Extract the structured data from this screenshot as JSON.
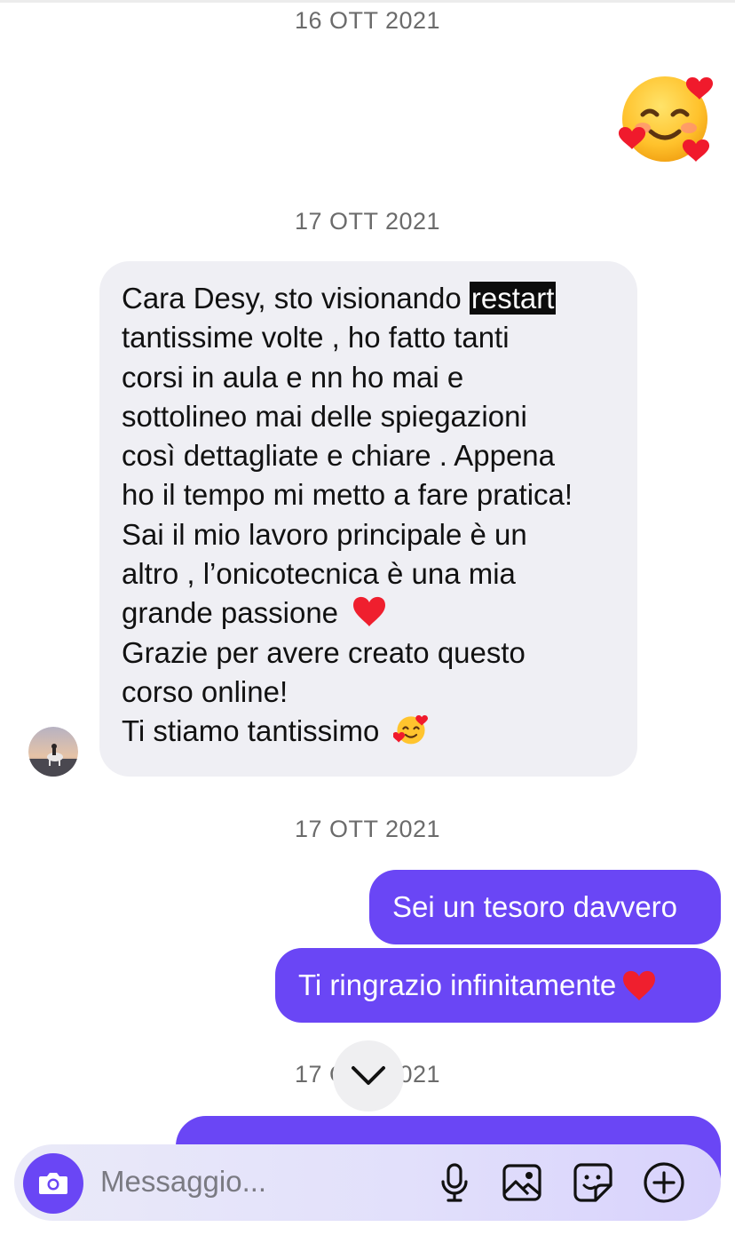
{
  "dates": [
    "16 OTT 2021",
    "17 OTT 2021",
    "17 OTT 2021",
    "17 OTT 2021"
  ],
  "sent_emoji": "smiling-face-with-hearts",
  "incoming": {
    "lines": [
      "Cara Desy, sto visionando ",
      "restart",
      "tantissime volte , ho fatto tanti",
      "corsi in aula e nn ho mai e",
      "sottolineo mai delle spiegazioni",
      "così dettagliate e chiare . Appena",
      "ho il tempo mi metto a fare pratica!",
      "Sai il mio lavoro principale è un",
      "altro , l’onicotecnica è una mia",
      "grande passione ",
      "Grazie per avere creato questo",
      "corso online!",
      "Ti stiamo tantissimo "
    ]
  },
  "outgoing": [
    {
      "text": "Sei un tesoro davvero"
    },
    {
      "text": "Ti ringrazio infinitamente "
    }
  ],
  "composer": {
    "placeholder": "Messaggio...",
    "icons": [
      "camera-icon",
      "microphone-icon",
      "gallery-icon",
      "sticker-icon",
      "plus-icon"
    ]
  },
  "colors": {
    "accent": "#6a46f5",
    "incoming_bubble": "#efeff4",
    "date_text": "#6b6b6b"
  }
}
